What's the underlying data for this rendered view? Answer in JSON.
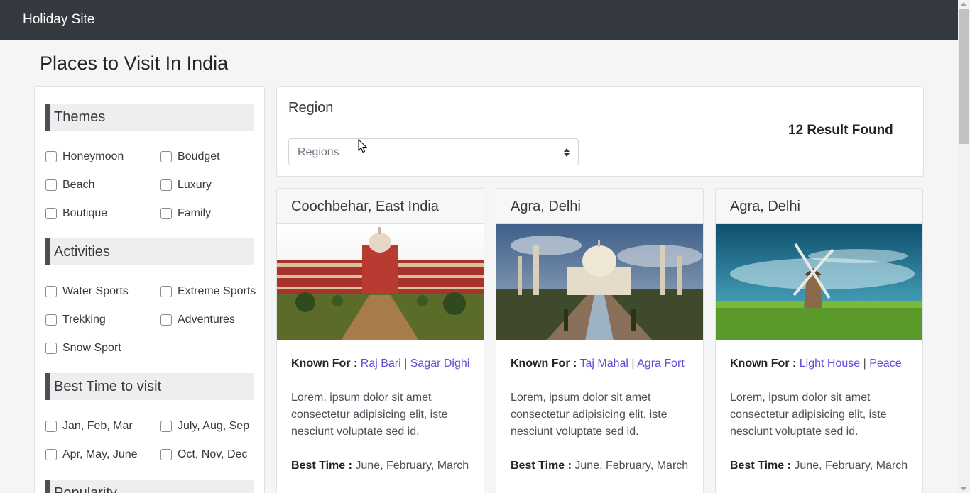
{
  "navbar": {
    "brand": "Holiday Site"
  },
  "page": {
    "title": "Places to Visit In India"
  },
  "filters": {
    "themes": {
      "heading": "Themes",
      "options": [
        "Honeymoon",
        "Boudget",
        "Beach",
        "Luxury",
        "Boutique",
        "Family"
      ]
    },
    "activities": {
      "heading": "Activities",
      "options": [
        "Water Sports",
        "Extreme Sports",
        "Trekking",
        "Adventures",
        "Snow Sport"
      ]
    },
    "best_time": {
      "heading": "Best Time to visit",
      "options": [
        "Jan, Feb, Mar",
        "July, Aug, Sep",
        "Apr, May, June",
        "Oct, Nov, Dec"
      ]
    },
    "popularity": {
      "heading": "Popularity"
    }
  },
  "region": {
    "label": "Region",
    "select_value": "Regions",
    "result_count": "12 Result Found"
  },
  "cards": [
    {
      "title": "Coochbehar, East India",
      "image": "palace-photo",
      "known_label": "Known For :",
      "links": [
        "Raj Bari",
        "Sagar Dighi"
      ],
      "separator": "|",
      "description": "Lorem, ipsum dolor sit amet consectetur adipisicing elit, iste nesciunt voluptate sed id.",
      "best_time_label": "Best Time :",
      "best_time": "June, February, March"
    },
    {
      "title": "Agra, Delhi",
      "image": "taj-mahal-photo",
      "known_label": "Known For :",
      "links": [
        "Taj Mahal",
        "Agra Fort"
      ],
      "separator": "|",
      "description": "Lorem, ipsum dolor sit amet consectetur adipisicing elit, iste nesciunt voluptate sed id.",
      "best_time_label": "Best Time :",
      "best_time": "June, February, March"
    },
    {
      "title": "Agra, Delhi",
      "image": "windmill-photo",
      "known_label": "Known For :",
      "links": [
        "Light House",
        "Peace"
      ],
      "separator": "|",
      "description": "Lorem, ipsum dolor sit amet consectetur adipisicing elit, iste nesciunt voluptate sed id.",
      "best_time_label": "Best Time :",
      "best_time": "June, February, March"
    }
  ],
  "colors": {
    "navbar": "#343a40",
    "link": "#5b4fd8",
    "section_bar": "#495057"
  }
}
